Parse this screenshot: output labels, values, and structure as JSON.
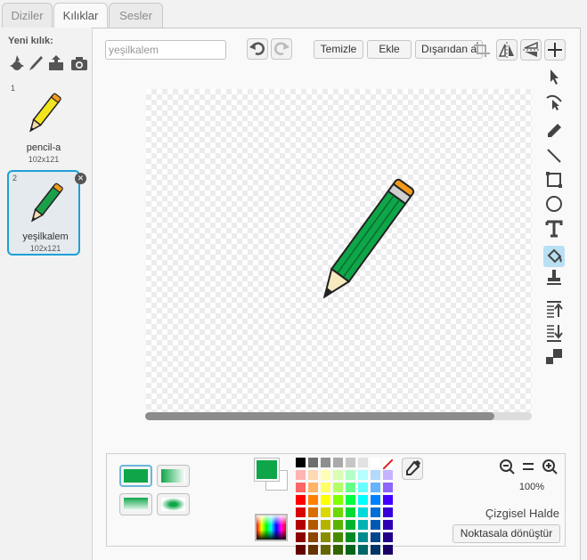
{
  "tabs": [
    "Diziler",
    "Kılıklar",
    "Sesler"
  ],
  "active_tab": "Kılıklar",
  "new_costume_label": "Yeni kılık:",
  "new_costume_icons": [
    "paint-from-library-icon",
    "paint-brush-icon",
    "upload-icon",
    "camera-icon"
  ],
  "costumes": [
    {
      "number": "1",
      "name": "pencil-a",
      "size": "102x121",
      "color": "#f2e51f",
      "selected": false
    },
    {
      "number": "2",
      "name": "yeşilkalem",
      "size": "102x121",
      "color": "#1aa04a",
      "selected": true
    }
  ],
  "editor": {
    "name_value": "yeşilkalem",
    "clear_label": "Temizle",
    "add_label": "Ekle",
    "import_label": "Dışarıdan al"
  },
  "tools": [
    "select-icon",
    "reshape-icon",
    "pencil-icon",
    "line-icon",
    "rectangle-icon",
    "ellipse-icon",
    "text-icon",
    "paint-bucket-icon",
    "stamp-icon",
    "bring-forward-icon",
    "send-backward-icon",
    "set-costume-center-icon"
  ],
  "active_tool": "paint-bucket-icon",
  "zoom": "100%",
  "mode_label": "Çizgisel Halde",
  "convert_label": "Noktasala dönüştür",
  "primary_color": "#0ea648",
  "secondary_color": "#ffffff",
  "palette_grays": [
    "#000000",
    "#6e6e6e",
    "#8e8e8e",
    "#aaaaaa",
    "#c6c6c6",
    "#e2e2e2",
    "#ffffff"
  ],
  "palette_hues": [
    "#ff0000",
    "#ff8000",
    "#ffff00",
    "#80ff00",
    "#00ff40",
    "#00ffff",
    "#0080ff",
    "#4000ff",
    "#c000ff",
    "#ff00c0"
  ]
}
